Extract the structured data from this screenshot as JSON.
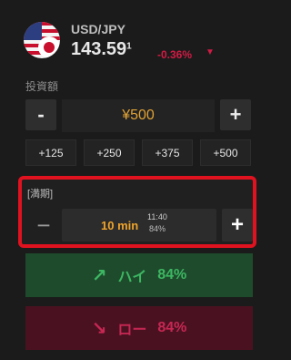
{
  "asset": {
    "pair": "USD/JPY",
    "price_main": "143.59",
    "price_superscript": "1",
    "change": "-0.36%",
    "flag_icon": "us-flag-icon"
  },
  "investment": {
    "label": "投資額",
    "amount": "¥500",
    "minus_label": "-",
    "plus_label": "+",
    "quick_amounts": [
      "+125",
      "+250",
      "+375",
      "+500"
    ]
  },
  "expiry": {
    "label": "[満期]",
    "minus_label": "−",
    "plus_label": "+",
    "duration": "10 min",
    "time": "11:40",
    "payout": "84%"
  },
  "trade": {
    "high_label": "ハイ",
    "high_payout": "84%",
    "low_label": "ロー",
    "low_payout": "84%"
  },
  "colors": {
    "accent": "#e0a235",
    "up": "#3cb762",
    "down": "#c72753",
    "highlight_border": "#e0121f"
  }
}
